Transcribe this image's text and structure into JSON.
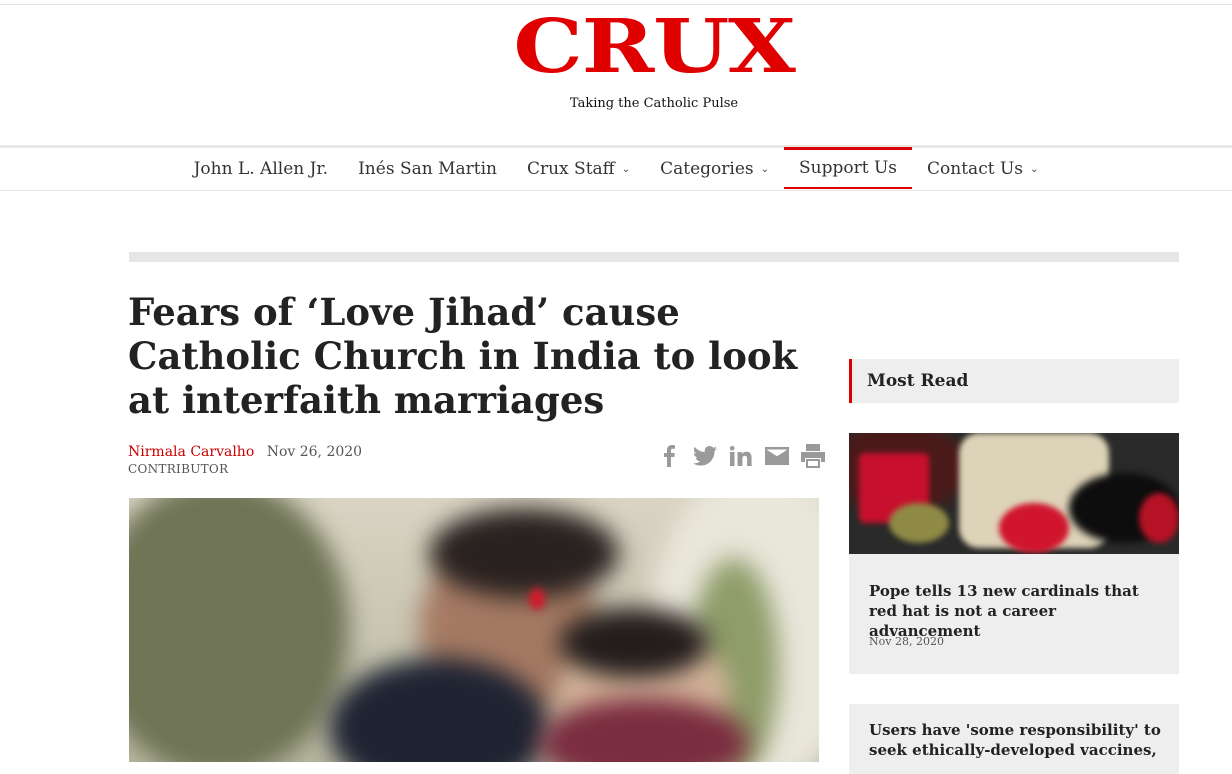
{
  "site": {
    "logo_text": "CRUX",
    "tagline": "Taking the Catholic Pulse"
  },
  "nav": {
    "items": [
      {
        "label": "John L. Allen Jr.",
        "dropdown": false
      },
      {
        "label": "Inés San Martin",
        "dropdown": false
      },
      {
        "label": "Crux Staff",
        "dropdown": true
      },
      {
        "label": "Categories",
        "dropdown": true
      },
      {
        "label": "Support Us",
        "dropdown": false,
        "active": true
      },
      {
        "label": "Contact Us",
        "dropdown": true
      }
    ]
  },
  "article": {
    "title": "Fears of ‘Love Jihad’ cause Catholic Church in India to look at interfaith marriages",
    "author": "Nirmala Carvalho",
    "date": "Nov 26, 2020",
    "author_role": "CONTRIBUTOR"
  },
  "share": {
    "icons": [
      "facebook-icon",
      "twitter-icon",
      "linkedin-icon",
      "email-icon",
      "print-icon"
    ]
  },
  "sidebar": {
    "heading": "Most Read",
    "cards": [
      {
        "title": "Pope tells 13 new cardinals that red hat is not a career advancement",
        "date": "Nov 28, 2020"
      },
      {
        "title": "Users have 'some responsibility' to seek ethically-developed vaccines,"
      }
    ]
  },
  "colors": {
    "accent": "#e00000",
    "author_link": "#cc0000",
    "icon_grey": "#9a9a9a",
    "panel_bg": "#eeeeee"
  }
}
